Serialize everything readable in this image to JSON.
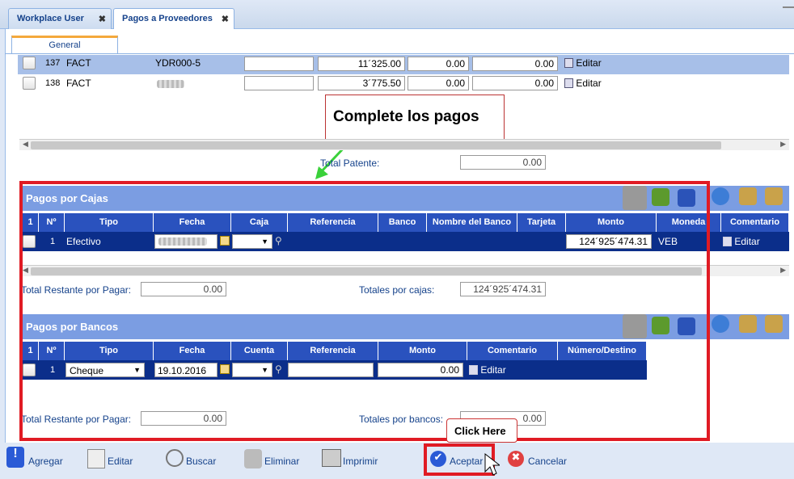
{
  "tabs": [
    {
      "label": "Workplace User"
    },
    {
      "label": "Pagos a Proveedores"
    }
  ],
  "subtab": "General",
  "top_rows": [
    {
      "num": "137",
      "tipo": "FACT",
      "ref": "YDR000-5",
      "monto": "11´325.00",
      "v1": "0.00",
      "v2": "0.00",
      "action": "Editar"
    },
    {
      "num": "138",
      "tipo": "FACT",
      "ref": "",
      "monto": "3´775.50",
      "v1": "0.00",
      "v2": "0.00",
      "action": "Editar"
    }
  ],
  "annotation": "Complete los pagos",
  "total_patente": {
    "label": "Total Patente:",
    "value": "0.00"
  },
  "cajas": {
    "title": "Pagos por Cajas",
    "headers": [
      "1",
      "Nº",
      "Tipo",
      "Fecha",
      "Caja",
      "Referencia",
      "Banco",
      "Nombre del Banco",
      "Tarjeta",
      "Monto",
      "Moneda",
      "Comentario"
    ],
    "row": {
      "num": "1",
      "tipo": "Efectivo",
      "monto": "124´925´474.31",
      "moneda": "VEB",
      "action": "Editar"
    },
    "restante_label": "Total Restante por Pagar:",
    "restante_value": "0.00",
    "totales_label": "Totales por cajas:",
    "totales_value": "124´925´474.31"
  },
  "bancos": {
    "title": "Pagos por Bancos",
    "headers": [
      "1",
      "Nº",
      "Tipo",
      "Fecha",
      "Cuenta",
      "Referencia",
      "Monto",
      "Comentario",
      "Número/Destino"
    ],
    "row": {
      "num": "1",
      "tipo": "Cheque",
      "fecha": "19.10.2016",
      "monto": "0.00",
      "action": "Editar"
    },
    "restante_label": "Total Restante por Pagar:",
    "restante_value": "0.00",
    "totales_label": "Totales por bancos:",
    "totales_value": "0.00"
  },
  "click_here": "Click Here",
  "toolbar": {
    "agregar": "Agregar",
    "editar": "Editar",
    "buscar": "Buscar",
    "eliminar": "Eliminar",
    "imprimir": "Imprimir",
    "aceptar": "Aceptar",
    "cancelar": "Cancelar"
  },
  "colors": {
    "accent": "#e01b24",
    "header": "#2a52be",
    "section": "#7b9de2",
    "row_selected": "#0b2e8a"
  }
}
